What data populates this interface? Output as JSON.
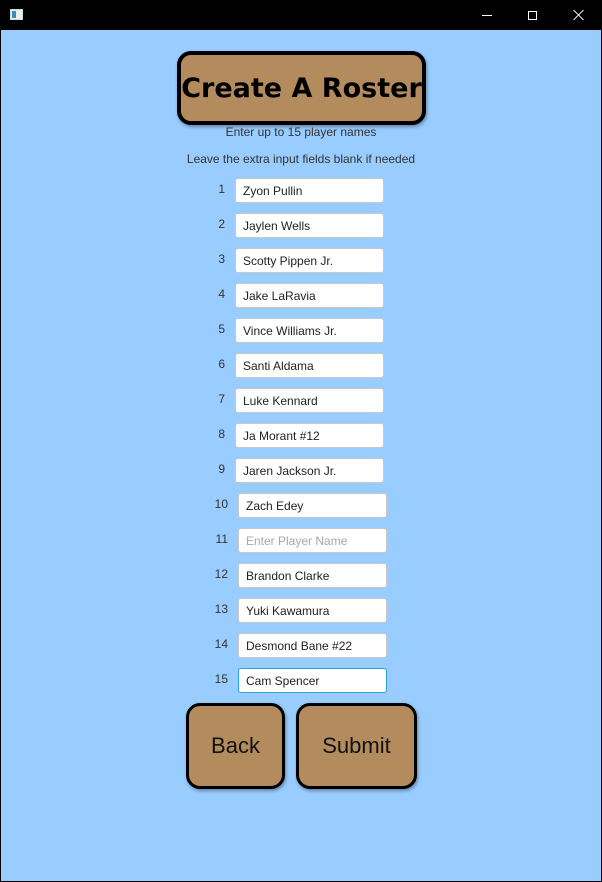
{
  "window": {
    "title": "",
    "controls": {
      "minimize_icon": "minimize-icon",
      "maximize_icon": "maximize-icon",
      "close_icon": "close-icon"
    }
  },
  "header": {
    "title": "Create A Roster",
    "instruction_1": "Enter up to 15 player names",
    "instruction_2": "Leave the extra input fields blank if needed"
  },
  "players": [
    {
      "number": "1",
      "value": "Zyon Pullin",
      "placeholder": "Enter Player Name"
    },
    {
      "number": "2",
      "value": "Jaylen Wells",
      "placeholder": "Enter Player Name"
    },
    {
      "number": "3",
      "value": "Scotty Pippen Jr.",
      "placeholder": "Enter Player Name"
    },
    {
      "number": "4",
      "value": "Jake LaRavia",
      "placeholder": "Enter Player Name"
    },
    {
      "number": "5",
      "value": "Vince Williams Jr.",
      "placeholder": "Enter Player Name"
    },
    {
      "number": "6",
      "value": "Santi Aldama",
      "placeholder": "Enter Player Name"
    },
    {
      "number": "7",
      "value": "Luke Kennard",
      "placeholder": "Enter Player Name"
    },
    {
      "number": "8",
      "value": "Ja Morant #12",
      "placeholder": "Enter Player Name"
    },
    {
      "number": "9",
      "value": "Jaren Jackson Jr.",
      "placeholder": "Enter Player Name"
    },
    {
      "number": "10",
      "value": "Zach Edey",
      "placeholder": "Enter Player Name"
    },
    {
      "number": "11",
      "value": "",
      "placeholder": "Enter Player Name"
    },
    {
      "number": "12",
      "value": "Brandon Clarke",
      "placeholder": "Enter Player Name"
    },
    {
      "number": "13",
      "value": "Yuki Kawamura",
      "placeholder": "Enter Player Name"
    },
    {
      "number": "14",
      "value": "Desmond Bane #22",
      "placeholder": "Enter Player Name"
    },
    {
      "number": "15",
      "value": "Cam Spencer",
      "placeholder": "Enter Player Name",
      "focused": true
    }
  ],
  "buttons": {
    "back": "Back",
    "submit": "Submit"
  },
  "colors": {
    "background": "#99ccff",
    "button_fill": "#b38b5d",
    "button_border": "#000000",
    "focus_ring": "#2aa0e0"
  }
}
